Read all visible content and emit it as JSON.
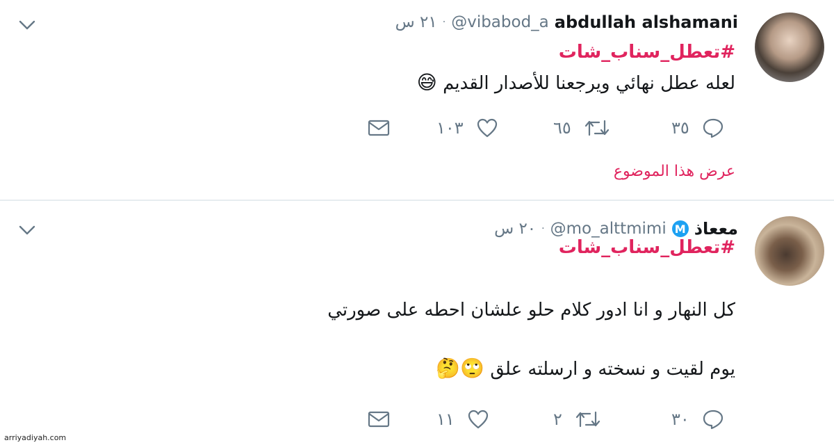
{
  "tweets": [
    {
      "name": "abdullah alshamani",
      "handle": "@vibabod_a",
      "separator": "·",
      "time": "٢١ س",
      "hashtag": "#تعطل_سناب_شات",
      "text": "لعله عطل نهائي ويرجعنا للأصدار القديم",
      "emoji": "😅",
      "replies": "٣٥",
      "retweets": "٦٥",
      "likes": "١٠٣",
      "thread_link": "عرض هذا الموضوع"
    },
    {
      "name": "مععاذ",
      "verified_letter": "M",
      "handle": "@mo_alttmimi",
      "separator": "·",
      "time": "٢٠ س",
      "hashtag": "#تعطل_سناب_شات",
      "text_line1": "كل النهار و انا ادور كلام حلو علشان احطه على صورتي",
      "text_line2": "يوم لقيت و نسخته و ارسلته علق",
      "emoji2": "🙄🤔",
      "replies": "٣٠",
      "retweets": "٢",
      "likes": "١١"
    }
  ],
  "watermark": "arriyadiyah.com",
  "colors": {
    "hashtag": "#e0245e",
    "muted": "#657786",
    "verified": "#1da1f2",
    "divider": "#e6ecf0"
  },
  "icons": [
    "reply-icon",
    "retweet-icon",
    "like-icon",
    "direct-message-icon",
    "chevron-down-icon",
    "verified-icon"
  ]
}
